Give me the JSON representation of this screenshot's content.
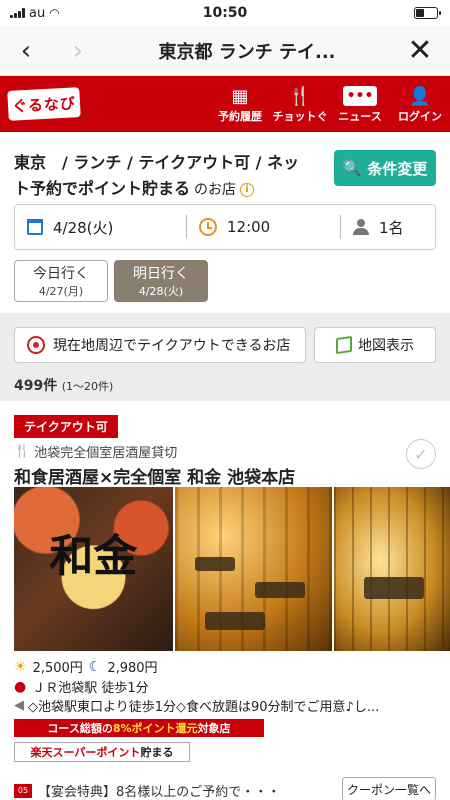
{
  "status": {
    "carrier": "au",
    "time": "10:50"
  },
  "nav": {
    "back": "‹",
    "forward": "›",
    "title": "東京都 ランチ テイ...",
    "close": "✕"
  },
  "header": {
    "logo": "ぐるなび",
    "menu": [
      {
        "label": "予約履歴",
        "icon": "calendar-icon"
      },
      {
        "label": "チョットぐ",
        "icon": "fork-knife-icon"
      },
      {
        "label": "ニュース",
        "icon": "news-icon"
      },
      {
        "label": "ログイン",
        "icon": "person-icon"
      }
    ]
  },
  "search": {
    "condition": "東京　/ ランチ / テイクアウト可 / ネット予約でポイント貯まる",
    "suffix": "のお店",
    "change_label": "条件変更",
    "date": "4/28(火)",
    "time": "12:00",
    "people": "1名",
    "today_label": "今日行く",
    "today_date": "4/27(月)",
    "tomorrow_label": "明日行く",
    "tomorrow_date": "4/28(火)"
  },
  "band": {
    "nearby_label": "現在地周辺でテイクアウトできるお店",
    "map_label": "地図表示",
    "count": "499件",
    "range": "(1〜20件)"
  },
  "shop": {
    "badge": "テイクアウト可",
    "genre": "池袋完全個室居酒屋貸切",
    "name": "和食居酒屋×完全個室 和金 池袋本店",
    "photo_text": "和金",
    "lunch_price": "2,500円",
    "dinner_price": "2,980円",
    "station": "ＪＲ池袋駅 徒歩1分",
    "pr": "◇池袋駅東口より徒歩1分◇食べ放題は90分制でご用意♪し...",
    "point_prefix": "コース総額の",
    "point_highlight": "8%ポイント還元",
    "point_suffix": "対象店",
    "rakuten_red": "楽天スーパーポイント",
    "rakuten_suffix": "貯まる",
    "coupon_tag": "05",
    "coupon_text": "【宴会特典】8名様以上のご予約で・・・",
    "coupon_button": "クーポン一覧へ"
  }
}
